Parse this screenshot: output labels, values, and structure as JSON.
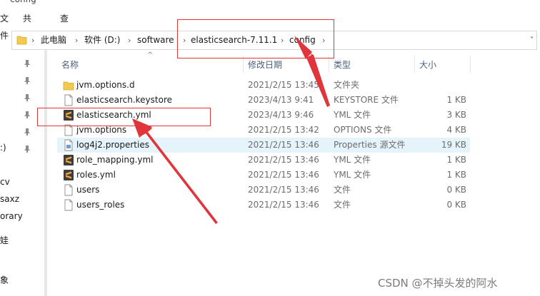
{
  "window": {
    "title": "config"
  },
  "ribbon": {
    "tabs": [
      "文件",
      "共享",
      "查看"
    ]
  },
  "address": {
    "crumbs": [
      "此电脑",
      "软件 (D:)",
      "software",
      "elasticsearch-7.11.1",
      "config"
    ],
    "separator": "›",
    "dropdown": "˅"
  },
  "left_nav": {
    "labels": [
      ":)",
      "cv",
      "saxz",
      "orary",
      "娃",
      "象"
    ]
  },
  "columns": {
    "name": "名称",
    "date": "修改日期",
    "type": "类型",
    "size": "大小",
    "sort_indicator": "^"
  },
  "files": [
    {
      "name": "jvm.options.d",
      "date": "2021/2/15 13:45",
      "type": "文件夹",
      "size": "",
      "icon": "folder-icon"
    },
    {
      "name": "elasticsearch.keystore",
      "date": "2023/4/13 9:41",
      "type": "KEYSTORE 文件",
      "size": "1 KB",
      "icon": "file-icon"
    },
    {
      "name": "elasticsearch.yml",
      "date": "2023/4/13 9:46",
      "type": "YML 文件",
      "size": "3 KB",
      "icon": "sublime-icon"
    },
    {
      "name": "jvm.options",
      "date": "2021/2/15 13:42",
      "type": "OPTIONS 文件",
      "size": "4 KB",
      "icon": "file-icon"
    },
    {
      "name": "log4j2.properties",
      "date": "2021/2/15 13:46",
      "type": "Properties 源文件",
      "size": "19 KB",
      "icon": "properties-icon",
      "selected": true
    },
    {
      "name": "role_mapping.yml",
      "date": "2021/2/15 13:46",
      "type": "YML 文件",
      "size": "1 KB",
      "icon": "sublime-icon"
    },
    {
      "name": "roles.yml",
      "date": "2021/2/15 13:46",
      "type": "YML 文件",
      "size": "1 KB",
      "icon": "sublime-icon"
    },
    {
      "name": "users",
      "date": "2021/2/15 13:46",
      "type": "文件",
      "size": "0 KB",
      "icon": "file-icon"
    },
    {
      "name": "users_roles",
      "date": "2021/2/15 13:46",
      "type": "文件",
      "size": "0 KB",
      "icon": "file-icon"
    }
  ],
  "colors": {
    "annotation": "#e0353a",
    "selected_row": "#e5f3fb",
    "header_text": "#4c607a"
  },
  "watermark": "CSDN @不掉头发的阿水"
}
